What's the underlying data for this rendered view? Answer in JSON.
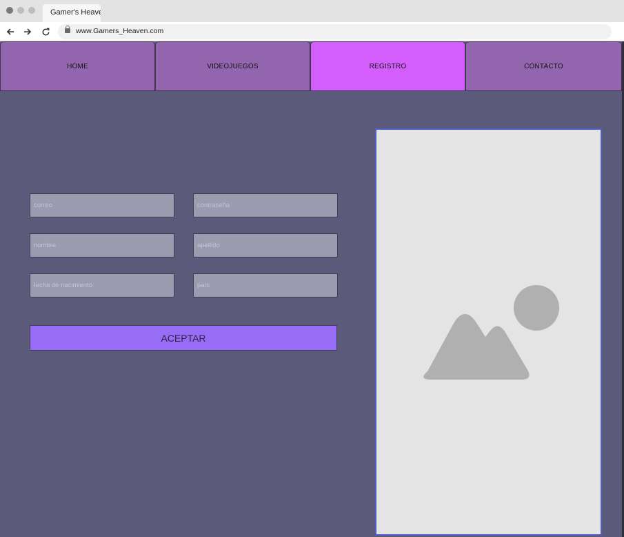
{
  "browser": {
    "tab_title": "Gamer's Heaven",
    "url": "www.Gamers_Heaven.com",
    "icons": {
      "back": "arrow-left-icon",
      "forward": "arrow-right-icon",
      "reload": "reload-icon",
      "lock": "lock-icon"
    }
  },
  "nav": {
    "items": [
      {
        "label": "HOME"
      },
      {
        "label": "VIDEOJUEGOS"
      },
      {
        "label": "REGISTRO",
        "active": true
      },
      {
        "label": "CONTACTO"
      }
    ]
  },
  "form": {
    "fields": [
      {
        "placeholder": "correo",
        "value": ""
      },
      {
        "placeholder": "contraseña",
        "value": ""
      },
      {
        "placeholder": "nombre",
        "value": ""
      },
      {
        "placeholder": "apellido",
        "value": ""
      },
      {
        "placeholder": "fecha de nacimiento",
        "value": ""
      },
      {
        "placeholder": "país",
        "value": ""
      }
    ],
    "submit_label": "ACEPTAR"
  },
  "image_placeholder": {
    "icon": "image-placeholder-icon"
  },
  "colors": {
    "page_bg": "#5b5a7a",
    "nav_item": "#9365ae",
    "nav_item_active": "#d35efc",
    "input_bg": "#9c9cb0",
    "submit_bg": "#976cf6",
    "image_box_bg": "#e4e4e4",
    "image_box_border": "#4f5ec4"
  }
}
